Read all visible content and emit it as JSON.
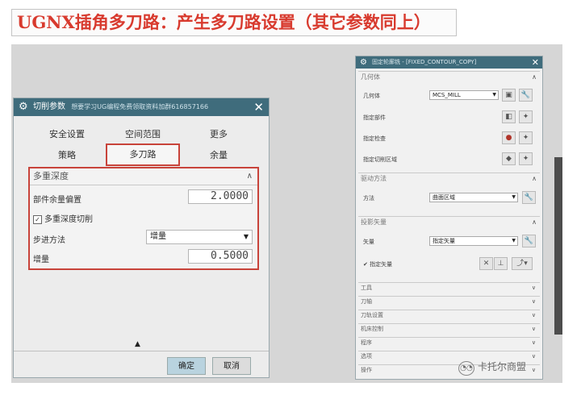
{
  "banner": {
    "title": "UGNX插角多刀路：产生多刀路设置（其它参数同上）"
  },
  "cut_dialog": {
    "title": "切削参数",
    "subtitle": "想要学习UG编程免费领取资料加群616857166",
    "tabs": [
      "安全设置",
      "空间范围",
      "更多",
      "策略",
      "多刀路",
      "余量"
    ],
    "active_tab": "多刀路",
    "panel": {
      "header": "多重深度",
      "offset_label": "部件余量偏置",
      "offset_value": "2.0000",
      "multi_depth_label": "多重深度切削",
      "multi_depth_checked": "✓",
      "step_label": "步进方法",
      "step_value": "增量",
      "increment_label": "增量",
      "increment_value": "0.5000"
    },
    "ok_label": "确定",
    "cancel_label": "取消"
  },
  "contour_dialog": {
    "title": "固定轮廓铣 - [FIXED_CONTOUR_COPY]",
    "geometry": {
      "header": "几何体",
      "geometry_label": "几何体",
      "geometry_value": "MCS_MILL",
      "part_label": "指定部件",
      "check_label": "指定检查",
      "cut_area_label": "指定切削区域"
    },
    "drive": {
      "header": "驱动方法",
      "method_label": "方法",
      "method_value": "曲面区域"
    },
    "projection": {
      "header": "投影矢量",
      "vector_label": "矢量",
      "vector_value": "指定矢量",
      "flip_label": "指定矢量"
    },
    "collapsed_sections": [
      "工具",
      "刀轴",
      "刀轨设置",
      "机床控制",
      "程序",
      "选项",
      "操作"
    ]
  },
  "watermark": {
    "text": "卡托尔商盟"
  }
}
